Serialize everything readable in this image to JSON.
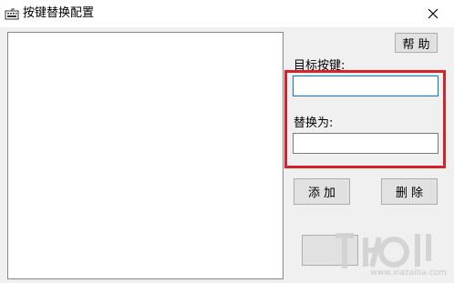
{
  "window": {
    "title": "按键替换配置",
    "app_icon": "keyboard-icon",
    "close_icon": "close-icon"
  },
  "main": {
    "help_button": "帮助",
    "target_key_label": "目标按键:",
    "target_key_value": "",
    "replace_with_label": "替换为:",
    "replace_with_value": "",
    "add_button": "添加",
    "delete_button": "删除"
  },
  "annotation": {
    "highlight_color": "#d6232a"
  },
  "watermark": {
    "text": "www.xiazaiba.com"
  }
}
